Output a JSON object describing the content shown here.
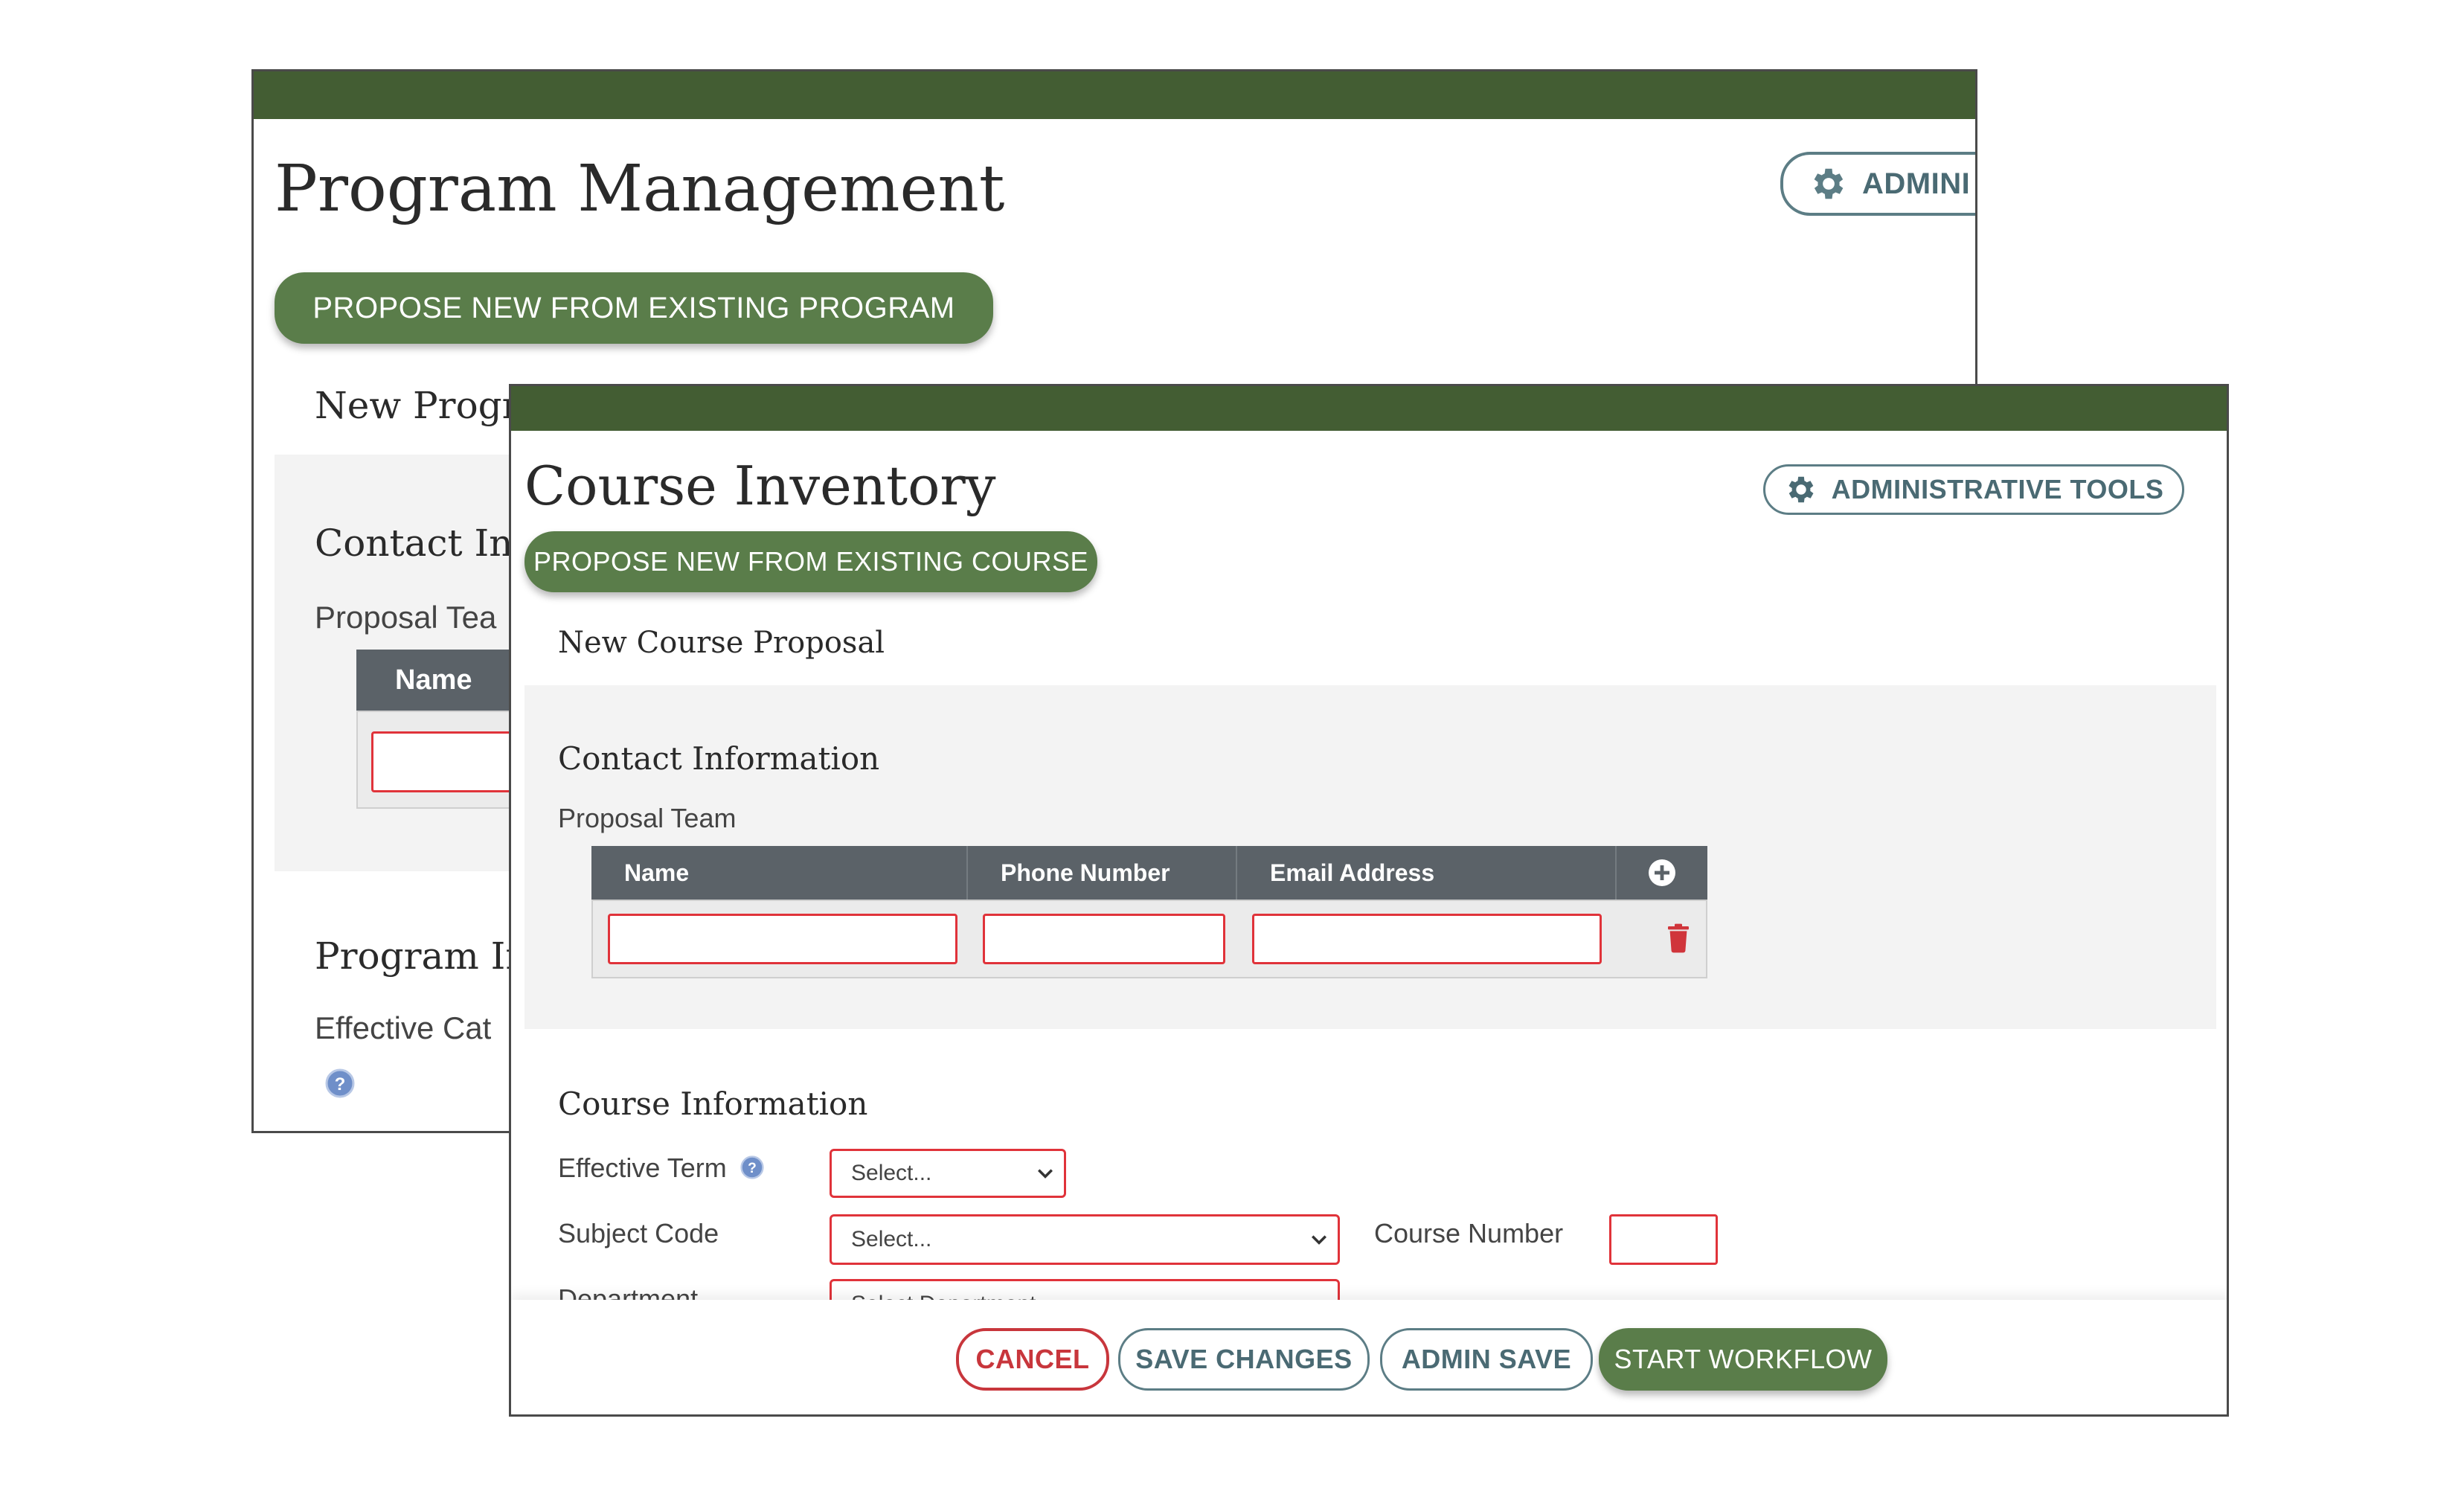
{
  "back_window": {
    "title": "Program Management",
    "admin_label": "ADMINI",
    "propose_label": "PROPOSE NEW FROM EXISTING PROGRAM",
    "new_heading": "New Progr",
    "contact_heading": "Contact Inf",
    "team_label": "Proposal Tea",
    "name_col": "Name",
    "program_heading": "Program In",
    "effective_label": "Effective Cat"
  },
  "front_window": {
    "title": "Course Inventory",
    "admin_label": "ADMINISTRATIVE TOOLS",
    "propose_label": "PROPOSE NEW FROM EXISTING COURSE",
    "new_heading": "New Course Proposal",
    "contact_heading": "Contact Information",
    "team_label": "Proposal Team",
    "columns": [
      "Name",
      "Phone Number",
      "Email Address"
    ],
    "course_heading": "Course Information",
    "effective_term_label": "Effective Term",
    "effective_term_value": "Select...",
    "subject_code_label": "Subject Code",
    "subject_code_value": "Select...",
    "course_number_label": "Course Number",
    "department_label": "Department",
    "department_value": "Select Department",
    "footer": {
      "cancel": "CANCEL",
      "save_changes": "SAVE CHANGES",
      "admin_save": "ADMIN SAVE",
      "start_workflow": "START WORKFLOW"
    }
  },
  "colors": {
    "titlebar": "#435d33",
    "accent_green": "#5a7d4a",
    "outline_teal": "#5c7d85",
    "error_red": "#e0333a",
    "table_header": "#5b6268"
  },
  "icons": [
    "gear-icon",
    "help-icon",
    "add-circle-icon",
    "trash-icon",
    "chevron-down-icon"
  ]
}
